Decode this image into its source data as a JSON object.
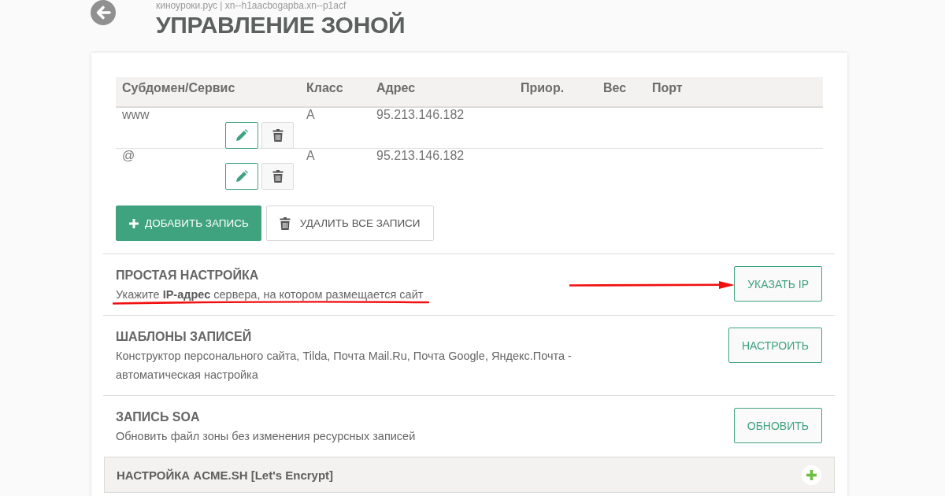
{
  "header": {
    "subtitle": "киноуроки.рус | xn--h1aacbogapba.xn--p1acf",
    "title": "УПРАВЛЕНИЕ ЗОНОЙ"
  },
  "records_table": {
    "columns": [
      "Субдомен/Сервис",
      "Класс",
      "Адрес",
      "Приор.",
      "Вес",
      "Порт"
    ],
    "rows": [
      {
        "cells": [
          "www",
          "A",
          "95.213.146.182"
        ]
      },
      {
        "cells": [
          "@",
          "A",
          "95.213.146.182"
        ]
      }
    ]
  },
  "table_actions": [
    {
      "kind": "add",
      "label": "ДОБАВИТЬ ЗАПИСЬ"
    },
    {
      "kind": "clear",
      "label": "УДАЛИТЬ ВСЕ ЗАПИСИ"
    }
  ],
  "sections": [
    {
      "title": "ПРОСТАЯ НАСТРОЙКА",
      "description": "Укажите **IP-адрес** сервера, на котором размещается сайт",
      "button": "УКАЗАТЬ IP",
      "annotated": true
    },
    {
      "title": "ШАБЛОНЫ ЗАПИСЕЙ",
      "description": "Конструктор персонального сайта, Tilda, Почта Mail.Ru, Почта Google, Яндекс.Почта - автоматическая настройка",
      "button": "НАСТРОИТЬ",
      "annotated": false
    },
    {
      "title": "ЗАПИСЬ SOA",
      "description": "Обновить файл зоны без изменения ресурсных записей",
      "button": "ОБНОВИТЬ",
      "annotated": false
    }
  ],
  "accordion": {
    "title": "НАСТРОЙКА ACME.SH [Let's Encrypt]",
    "expanded": false
  }
}
